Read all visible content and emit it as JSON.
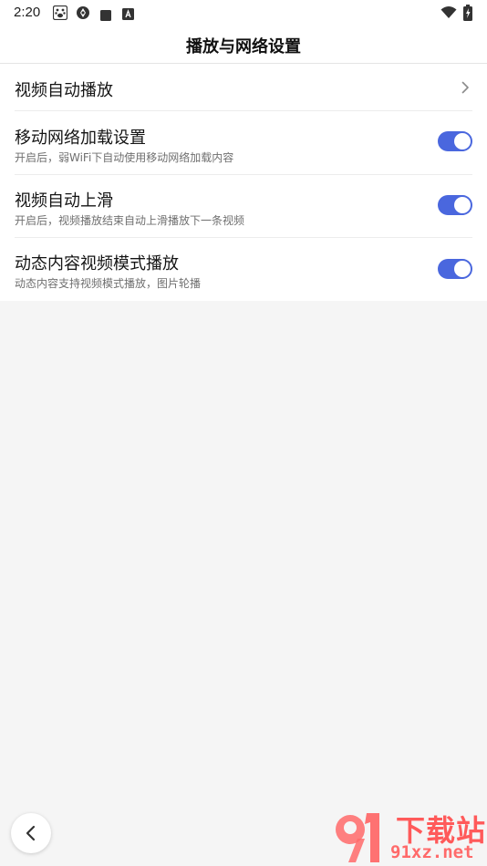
{
  "status_bar": {
    "time": "2:20",
    "icons": [
      "baidu-paw-icon",
      "aperture-icon",
      "square-icon",
      "keyboard-a-icon",
      "wifi-icon",
      "battery-charging-icon"
    ]
  },
  "header": {
    "title": "播放与网络设置"
  },
  "settings": {
    "items": [
      {
        "title": "视频自动播放",
        "type": "link"
      },
      {
        "title": "移动网络加载设置",
        "subtitle": "开启后，弱WiFi下自动使用移动网络加载内容",
        "type": "toggle",
        "on": true
      },
      {
        "title": "视频自动上滑",
        "subtitle": "开启后，视频播放结束自动上滑播放下一条视频",
        "type": "toggle",
        "on": true
      },
      {
        "title": "动态内容视频模式播放",
        "subtitle": "动态内容支持视频模式播放，图片轮播",
        "type": "toggle",
        "on": true
      }
    ]
  },
  "colors": {
    "accent": "#4a67de",
    "background": "#f5f5f5",
    "card": "#ffffff",
    "watermark": "#ff5a5a"
  },
  "watermark": {
    "brand": "下载站",
    "url": "91xz.net"
  }
}
